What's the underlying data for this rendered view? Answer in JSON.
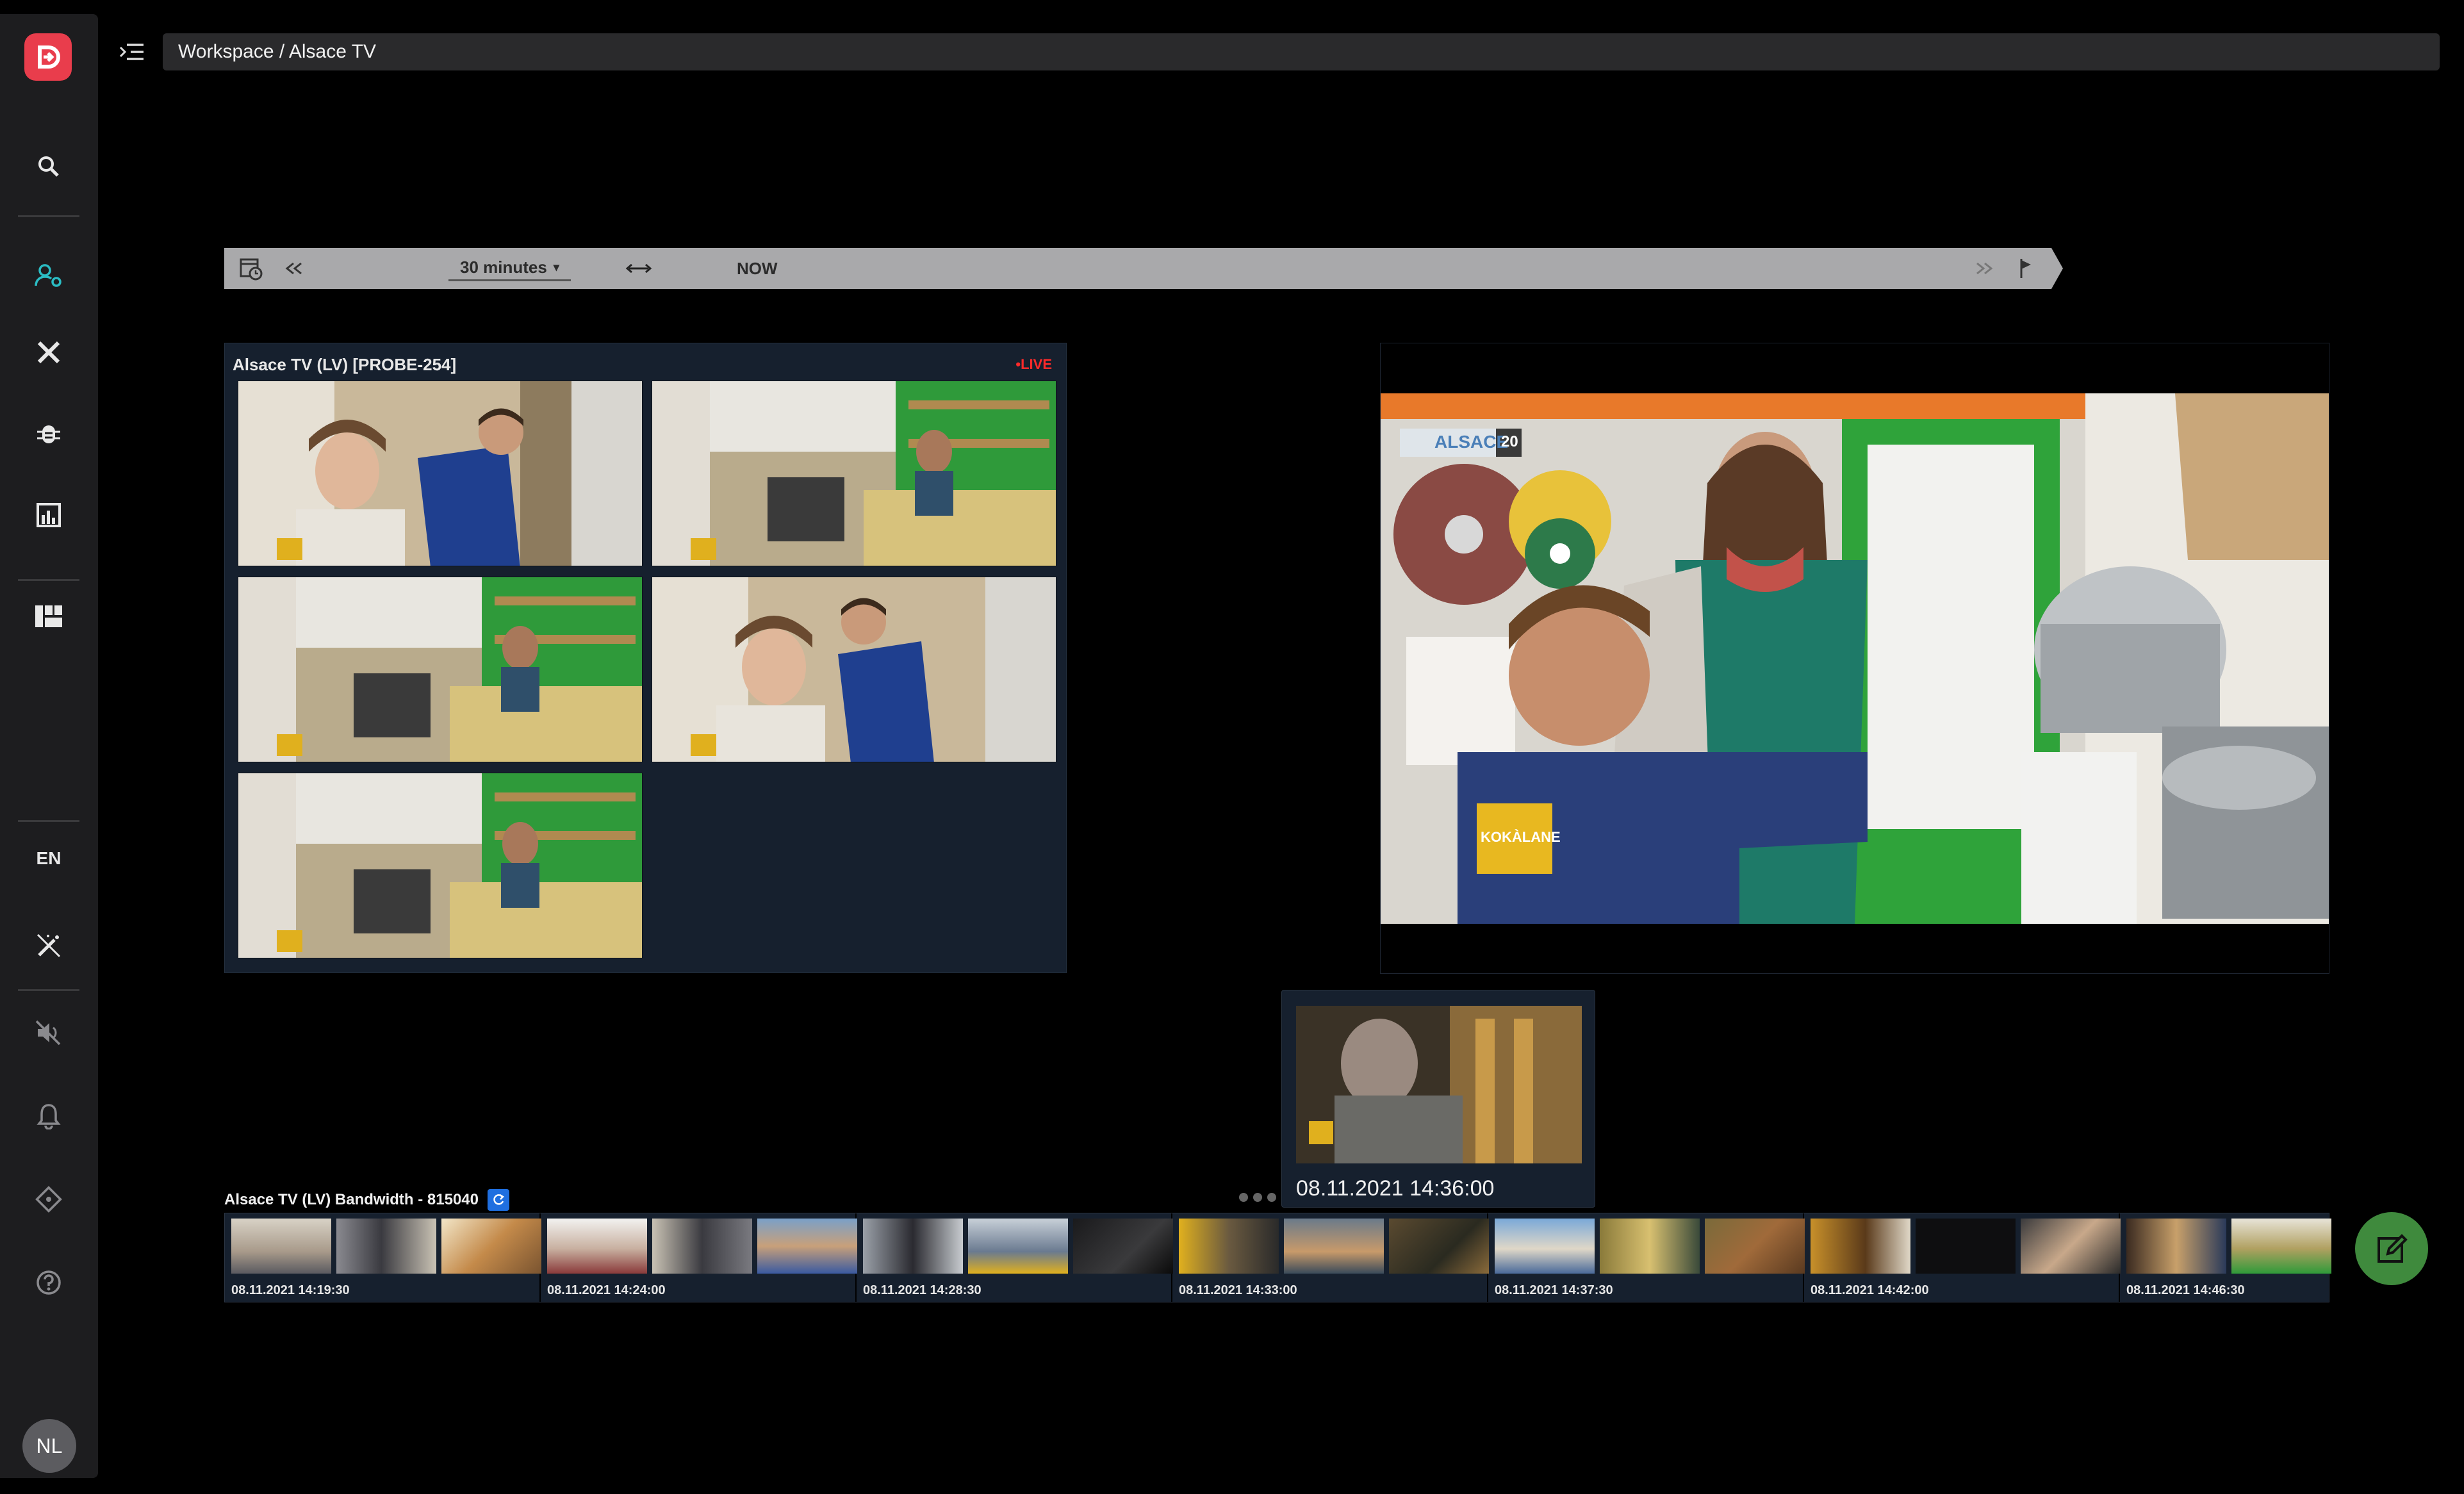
{
  "header": {
    "breadcrumb": "Workspace / Alsace TV"
  },
  "sidebar": {
    "language": "EN",
    "avatar_initials": "NL",
    "icons": [
      "search-icon",
      "user-settings-icon",
      "tools-icon",
      "bug-icon",
      "analytics-icon",
      "dashboard-icon",
      "magic-off-icon",
      "volume-off-icon",
      "bell-icon",
      "ticket-icon",
      "help-icon"
    ],
    "accent_color": "#2bbdc4",
    "logo_color": "#e93d4c"
  },
  "timebar": {
    "duration_label": "30 minutes",
    "now_label": "NOW"
  },
  "multiview": {
    "title": "Alsace TV (LV) [PROBE-254]",
    "live_label": "•LIVE"
  },
  "preview": {
    "timestamp": "08.11.2021 14:36:00"
  },
  "timeline": {
    "title": "Alsace TV (LV) Bandwidth - 815040",
    "segments": [
      {
        "time": "08.11.2021 14:19:30"
      },
      {
        "time": "08.11.2021 14:24:00"
      },
      {
        "time": "08.11.2021 14:28:30"
      },
      {
        "time": "08.11.2021 14:33:00"
      },
      {
        "time": "08.11.2021 14:37:30"
      },
      {
        "time": "08.11.2021 14:42:00"
      },
      {
        "time": "08.11.2021 14:46:30"
      }
    ]
  },
  "main_video": {
    "channel_logo_text": "ALSACE",
    "channel_logo_number": "20",
    "corner_logo_text": "KOKÀLANE"
  },
  "colors": {
    "panel_bg": "#16202e",
    "live_red": "#ff2a2a",
    "fab_green": "#3f8a3d"
  }
}
